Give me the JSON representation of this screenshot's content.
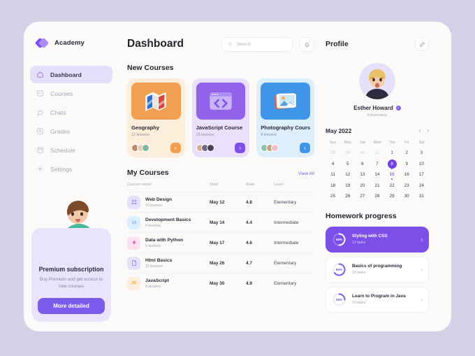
{
  "brand": {
    "name": "Academy",
    "logo_icon": "diamond-logo-icon",
    "accent": "#7b5bec"
  },
  "sidebar": {
    "items": [
      {
        "label": "Dashboard",
        "icon": "home-icon",
        "active": true
      },
      {
        "label": "Courses",
        "icon": "book-icon",
        "active": false
      },
      {
        "label": "Chats",
        "icon": "chat-bubble-icon",
        "active": false
      },
      {
        "label": "Grades",
        "icon": "grades-icon",
        "active": false
      },
      {
        "label": "Schedule",
        "icon": "calendar-icon",
        "active": false
      },
      {
        "label": "Settings",
        "icon": "gear-icon",
        "active": false
      }
    ],
    "premium": {
      "title": "Premium subscription",
      "description": "Buy Premium and get access to new courses",
      "button_label": "More detailed",
      "illustration": "boy-with-laptop-illustration"
    }
  },
  "header": {
    "title": "Dashboard",
    "search": {
      "value": "",
      "placeholder": "Search",
      "icon": "search-icon"
    },
    "notifications": {
      "icon": "bell-icon",
      "has_unread": true
    }
  },
  "new_courses": {
    "title": "New Courses",
    "cards": [
      {
        "name": "Geography",
        "lessons": "12 lessons",
        "thumb_icon": "folded-map-icon",
        "bg": "#fdeedb",
        "thumb_bg": "#f0a050",
        "arrow_bg": "#f0a050"
      },
      {
        "name": "JavaScript Course",
        "lessons": "15 lessons",
        "thumb_icon": "code-window-icon",
        "bg": "#e9e0fb",
        "thumb_bg": "#9263ea",
        "arrow_bg": "#7b4fe8"
      },
      {
        "name": "Photography Course",
        "lessons": "8 lessons",
        "thumb_icon": "photo-stack-icon",
        "bg": "#ddeefc",
        "thumb_bg": "#3f96e8",
        "arrow_bg": "#3f96e8"
      }
    ]
  },
  "my_courses": {
    "title": "My Courses",
    "view_all_label": "View All",
    "columns": [
      "Course name",
      "Start",
      "Rate",
      "Level"
    ],
    "rows": [
      {
        "name": "Web Design",
        "lessons": "10 lessons",
        "start": "May 12",
        "rate": "4.8",
        "level": "Elementary",
        "icon": "frame-crop-icon",
        "icon_bg": "#e7e1fb",
        "icon_color": "#7b5bec"
      },
      {
        "name": "Development Basics",
        "lessons": "8 lessons",
        "start": "May 14",
        "rate": "4.4",
        "level": "Intermediate",
        "icon": "code-brackets-icon",
        "icon_bg": "#ddeefc",
        "icon_color": "#4a9ae6"
      },
      {
        "name": "Data with Python",
        "lessons": "5 lessons",
        "start": "May 17",
        "rate": "4.6",
        "level": "Intermediate",
        "icon": "python-plus-icon",
        "icon_bg": "#fbe1f1",
        "icon_color": "#e060b0"
      },
      {
        "name": "Html Basics",
        "lessons": "12 lessons",
        "start": "May 26",
        "rate": "4.7",
        "level": "Elementary",
        "icon": "html-file-icon",
        "icon_bg": "#e7e1fb",
        "icon_color": "#7b5bec"
      },
      {
        "name": "JavaScript",
        "lessons": "8 lessons",
        "start": "May 30",
        "rate": "4.9",
        "level": "Elementary",
        "icon": "js-badge-icon",
        "icon_bg": "#fdeedb",
        "icon_color": "#efa33f"
      }
    ]
  },
  "profile": {
    "title": "Profile",
    "edit_icon": "pencil-edit-icon",
    "avatar": "blond-boy-avatar",
    "name": "Esther Howard",
    "verified": true,
    "level": "Elementary"
  },
  "calendar": {
    "month": "May 2022",
    "prev_icon": "chevron-left-icon",
    "next_icon": "chevron-right-icon",
    "dow": [
      "Sun",
      "Mon",
      "Tue",
      "Wed",
      "Thu",
      "Fri",
      "Sat"
    ],
    "days": [
      {
        "n": "28",
        "mute": true
      },
      {
        "n": "29",
        "mute": true
      },
      {
        "n": "30",
        "mute": true
      },
      {
        "n": "31",
        "mute": true
      },
      {
        "n": "1"
      },
      {
        "n": "2"
      },
      {
        "n": "3"
      },
      {
        "n": "4"
      },
      {
        "n": "5"
      },
      {
        "n": "6"
      },
      {
        "n": "7"
      },
      {
        "n": "8",
        "selected": true,
        "pip": true
      },
      {
        "n": "9"
      },
      {
        "n": "10"
      },
      {
        "n": "11"
      },
      {
        "n": "12"
      },
      {
        "n": "13"
      },
      {
        "n": "14"
      },
      {
        "n": "15",
        "highlight": true,
        "pip": true
      },
      {
        "n": "16"
      },
      {
        "n": "17"
      },
      {
        "n": "18"
      },
      {
        "n": "19"
      },
      {
        "n": "20"
      },
      {
        "n": "21"
      },
      {
        "n": "22"
      },
      {
        "n": "23"
      },
      {
        "n": "24"
      },
      {
        "n": "25"
      },
      {
        "n": "26"
      },
      {
        "n": "27"
      },
      {
        "n": "28"
      },
      {
        "n": "29"
      },
      {
        "n": "30"
      },
      {
        "n": "31"
      }
    ]
  },
  "homework": {
    "title": "Homework progress",
    "items": [
      {
        "title": "Styling with CSS",
        "tasks": "12 tasks",
        "percent": 50,
        "percent_label": "50%",
        "active": true,
        "chevron": "chevron-right-icon"
      },
      {
        "title": "Basics of programming",
        "tasks": "18 tasks",
        "percent": 65,
        "percent_label": "65%",
        "active": false,
        "chevron": "chevron-right-icon"
      },
      {
        "title": "Learn to Program in Java",
        "tasks": "10 tasks",
        "percent": 25,
        "percent_label": "25%",
        "active": false,
        "chevron": "chevron-right-icon"
      }
    ]
  }
}
